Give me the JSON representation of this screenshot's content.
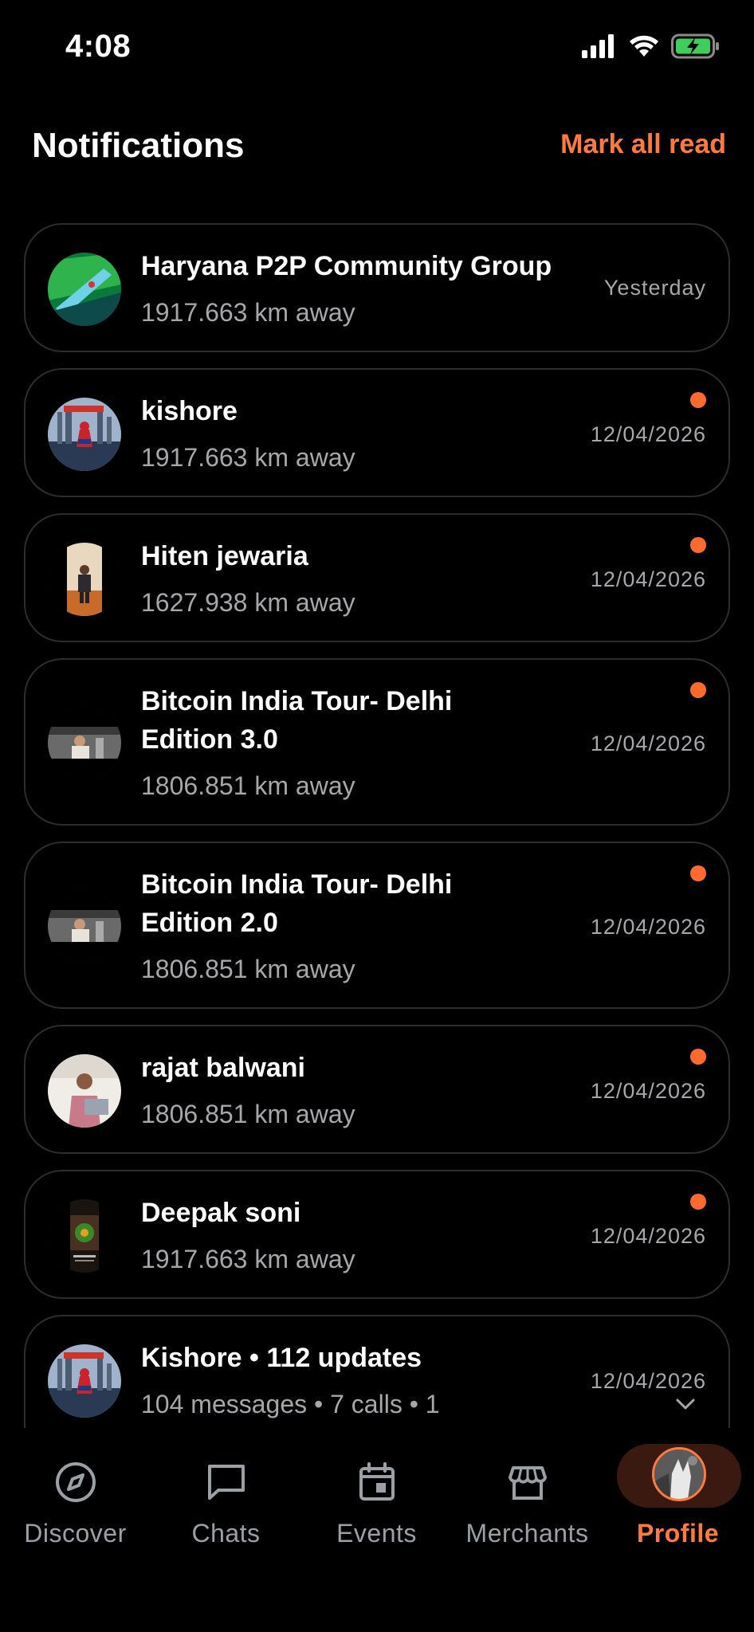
{
  "status": {
    "time": "4:08"
  },
  "header": {
    "title": "Notifications",
    "mark_all": "Mark all read"
  },
  "notifications": [
    {
      "name": "Haryana P2P Community Group",
      "sub": "1917.663 km away",
      "date": "Yesterday",
      "unread": false,
      "avatar": "green-map-image"
    },
    {
      "name": "kishore",
      "sub": "1917.663 km away",
      "date": "12/04/2026",
      "unread": true,
      "avatar": "spiderman-city-image"
    },
    {
      "name": "Hiten jewaria",
      "sub": "1627.938 km away",
      "date": "12/04/2026",
      "unread": true,
      "avatar": "man-standing-image"
    },
    {
      "name": "Bitcoin India Tour- Delhi Edition 3.0",
      "sub": "1806.851 km away",
      "date": "12/04/2026",
      "unread": true,
      "avatar": "gym-image"
    },
    {
      "name": "Bitcoin India Tour- Delhi Edition 2.0",
      "sub": "1806.851 km away",
      "date": "12/04/2026",
      "unread": true,
      "avatar": "gym-image"
    },
    {
      "name": "rajat balwani",
      "sub": "1806.851 km away",
      "date": "12/04/2026",
      "unread": true,
      "avatar": "man-laptop-image"
    },
    {
      "name": "Deepak soni",
      "sub": "1917.663 km away",
      "date": "12/04/2026",
      "unread": true,
      "avatar": "dark-poster-image"
    },
    {
      "name": "Kishore • 112 updates",
      "sub": "104 messages • 7 calls • 1",
      "date": "12/04/2026",
      "unread": false,
      "avatar": "spiderman-city-image"
    }
  ],
  "tabs": [
    {
      "label": "Discover",
      "icon": "compass-icon"
    },
    {
      "label": "Chats",
      "icon": "chat-bubble-icon"
    },
    {
      "label": "Events",
      "icon": "calendar-icon"
    },
    {
      "label": "Merchants",
      "icon": "store-icon"
    },
    {
      "label": "Profile",
      "icon": "profile-avatar",
      "active": true
    }
  ],
  "colors": {
    "accent": "#ff7a3d",
    "unread_dot": "#ff6a2f",
    "card_border": "#2c2c2e",
    "muted_text": "#a7a7ab"
  }
}
